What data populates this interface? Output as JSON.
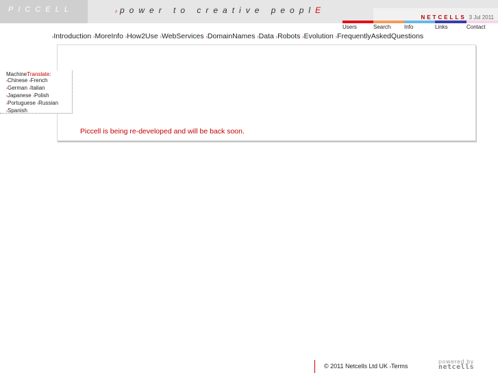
{
  "header": {
    "logo": "PICCELL",
    "tagline": "power to creative peopl",
    "tagline_end": "E",
    "brand": "NETCELLS",
    "date": "3 Jul 2011"
  },
  "topnav": {
    "items": [
      {
        "label": "Users",
        "color": "#e0101a"
      },
      {
        "label": "Search",
        "color": "#f59a5c"
      },
      {
        "label": "Info",
        "color": "#6ab8e6"
      },
      {
        "label": "Links",
        "color": "#3b3ba6"
      },
      {
        "label": "Contact",
        "color": "#f8d4e8"
      }
    ]
  },
  "mainnav": {
    "items": [
      "Introduction",
      "MoreInfo",
      "How2Use",
      "WebServices",
      "DomainNames",
      "Data",
      "Robots",
      "Evolution",
      "FrequentlyAskedQuestions"
    ]
  },
  "translate": {
    "title_prefix": "Machine",
    "title_highlight": "Translate:",
    "languages": [
      "Chinese",
      "French",
      "German",
      "Italian",
      "Japanese",
      "Polish",
      "Portuguese",
      "Russian",
      "Spanish"
    ]
  },
  "content": {
    "message": "Piccell is being re-developed and will be back soon."
  },
  "footer": {
    "copyright": "© 2011  Netcells Ltd UK",
    "terms": "Terms",
    "powered_by": "powered by",
    "powered_name": "netcells"
  }
}
